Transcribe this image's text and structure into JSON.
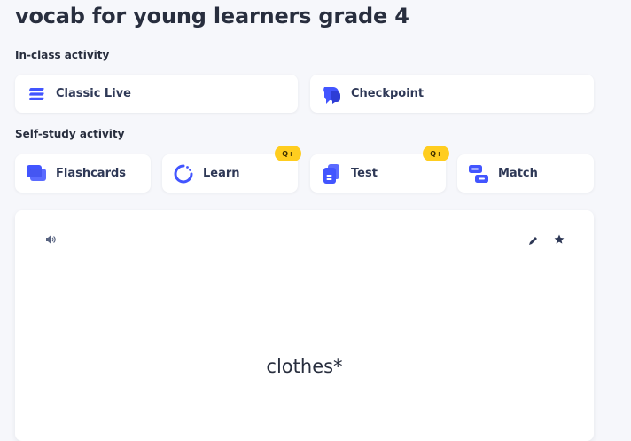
{
  "set_title": "vocab for young learners grade 4",
  "in_class": {
    "heading": "In-class activity",
    "items": [
      {
        "label": "Classic Live",
        "icon": "classic-live-icon"
      },
      {
        "label": "Checkpoint",
        "icon": "checkpoint-icon"
      }
    ]
  },
  "self_study": {
    "heading": "Self-study activity",
    "items": [
      {
        "label": "Flashcards",
        "icon": "flashcards-icon"
      },
      {
        "label": "Learn",
        "icon": "learn-icon",
        "badge": "Q+"
      },
      {
        "label": "Test",
        "icon": "test-icon",
        "badge": "Q+"
      },
      {
        "label": "Match",
        "icon": "match-icon"
      }
    ]
  },
  "flashcard": {
    "term": "clothes*",
    "icons": [
      "audio-icon",
      "edit-icon",
      "star-icon"
    ]
  },
  "colors": {
    "background": "#f6f7fb",
    "card": "#ffffff",
    "accent": "#4255ff",
    "badge": "#ffcd1f",
    "text": "#282e3e"
  }
}
